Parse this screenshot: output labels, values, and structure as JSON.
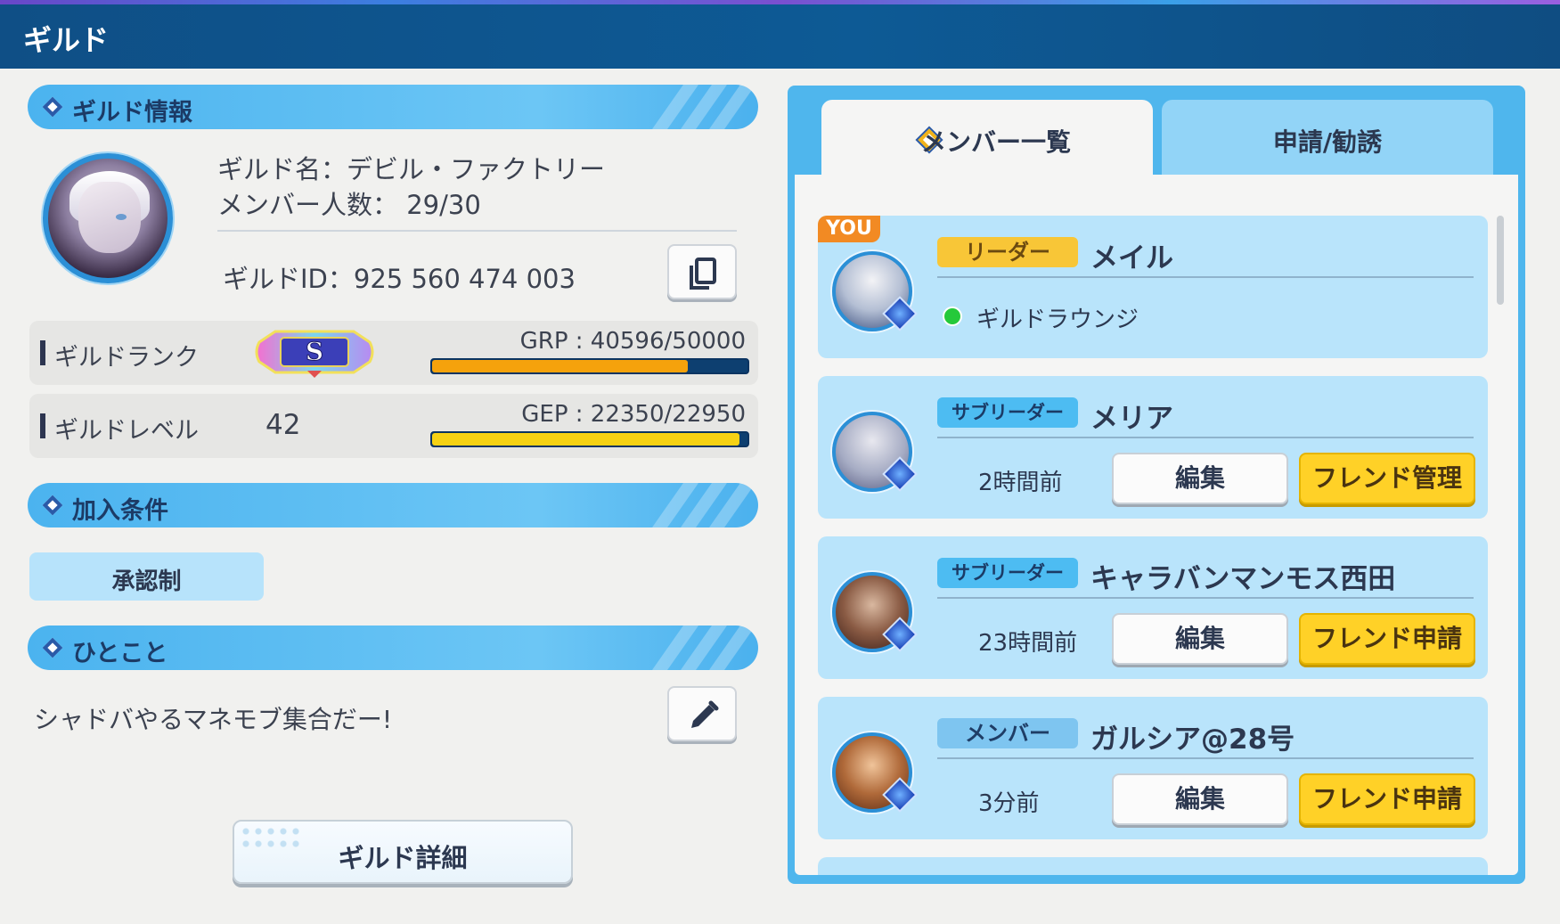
{
  "header": {
    "title": "ギルド"
  },
  "guild_info": {
    "section_title": "ギルド情報",
    "name_line": "ギルド名：デビル・ファクトリー",
    "members_line": "メンバー人数： 29/30",
    "id_line": "ギルドID：925 560 474 003"
  },
  "rank": {
    "label": "ギルドランク",
    "badge_letter": "S",
    "grp_text": "GRP : 40596/50000",
    "fill_fraction": 0.812,
    "fill_color": "#f5a20c"
  },
  "level": {
    "label": "ギルドレベル",
    "value": "42",
    "gep_text": "GEP : 22350/22950",
    "fill_fraction": 0.974,
    "fill_color": "#f6d214"
  },
  "conditions": {
    "section_title": "加入条件",
    "value": "承認制"
  },
  "comment": {
    "section_title": "ひとこと",
    "text": "シャドバやるマネモブ集合だー!"
  },
  "detail_button": "ギルド詳細",
  "tabs": {
    "members": "メンバー一覧",
    "requests": "申請/勧誘"
  },
  "members": [
    {
      "you_badge": "YOU",
      "role": "リーダー",
      "name": "メイル",
      "status": "ギルドラウンジ"
    },
    {
      "role": "サブリーダー",
      "name": "メリア",
      "time": "2時間前",
      "edit": "編集",
      "action": "フレンド管理"
    },
    {
      "role": "サブリーダー",
      "name": "キャラバンマンモス西田",
      "time": "23時間前",
      "edit": "編集",
      "action": "フレンド申請"
    },
    {
      "role": "メンバー",
      "name": "ガルシア@28号",
      "time": "3分前",
      "edit": "編集",
      "action": "フレンド申請"
    }
  ]
}
